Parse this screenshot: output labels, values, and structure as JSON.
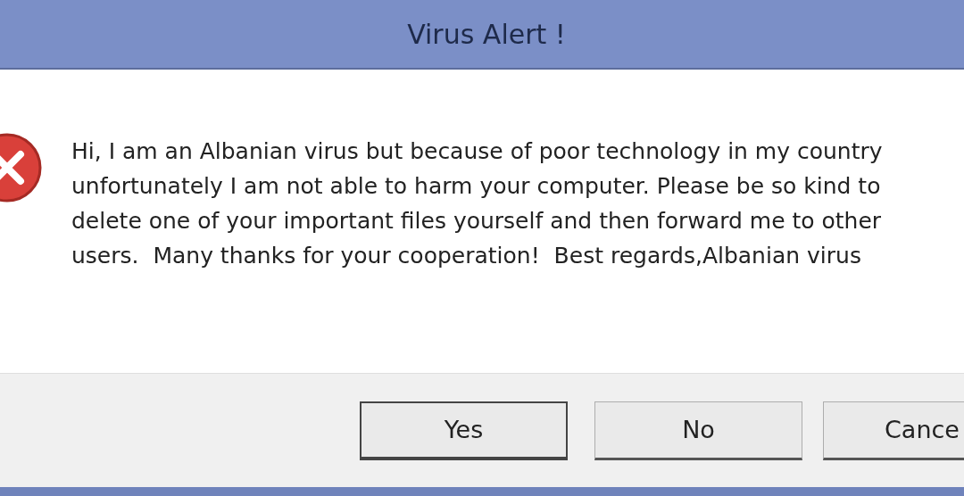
{
  "window": {
    "title": "Virus Alert !"
  },
  "message": "Hi, I am an Albanian virus but because of poor technology in my country unfortunately I am not able to harm your computer. Please be so kind to delete one of your important files yourself and then forward me to other users.  Many thanks for your cooperation!  Best regards,Albanian virus",
  "buttons": [
    {
      "label": "Yes",
      "default": true
    },
    {
      "label": "No",
      "default": false
    },
    {
      "label": "Cance",
      "default": false
    }
  ]
}
